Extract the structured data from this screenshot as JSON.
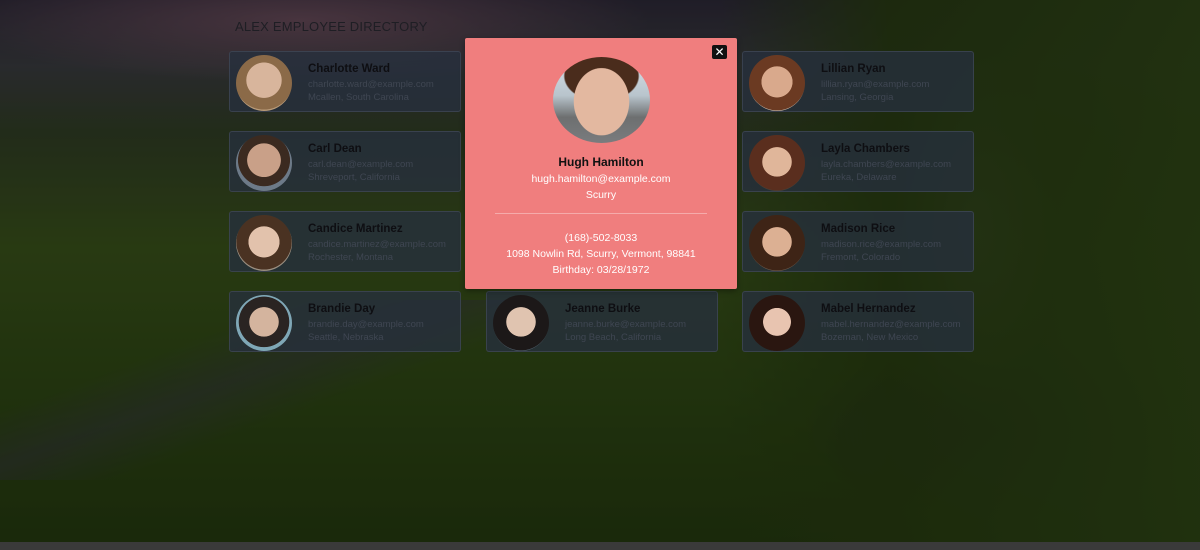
{
  "page": {
    "title": "ALEX EMPLOYEE DIRECTORY"
  },
  "employees": [
    {
      "name": "Charlotte Ward",
      "email": "charlotte.ward@example.com",
      "location": "Mcallen, South Carolina"
    },
    {
      "name": "Carl Dean",
      "email": "carl.dean@example.com",
      "location": "Shreveport, California"
    },
    {
      "name": "Candice Martinez",
      "email": "candice.martinez@example.com",
      "location": "Rochester, Montana"
    },
    {
      "name": "Brandie Day",
      "email": "brandie.day@example.com",
      "location": "Seattle, Nebraska"
    },
    {
      "name": "Jeanne Burke",
      "email": "jeanne.burke@example.com",
      "location": "Long Beach, California"
    },
    {
      "name": "Lillian Ryan",
      "email": "lillian.ryan@example.com",
      "location": "Lansing, Georgia"
    },
    {
      "name": "Layla Chambers",
      "email": "layla.chambers@example.com",
      "location": "Eureka, Delaware"
    },
    {
      "name": "Madison Rice",
      "email": "madison.rice@example.com",
      "location": "Fremont, Colorado"
    },
    {
      "name": "Mabel Hernandez",
      "email": "mabel.hernandez@example.com",
      "location": "Bozeman, New Mexico"
    }
  ],
  "modal": {
    "close_label": "✕",
    "name": "Hugh Hamilton",
    "email": "hugh.hamilton@example.com",
    "city": "Scurry",
    "phone": "(168)-502-8033",
    "address": "1098 Nowlin Rd, Scurry, Vermont, 98841",
    "birthday": "Birthday: 03/28/1972",
    "background_color": "#f07e7e"
  },
  "icons": {
    "close": "close-icon"
  }
}
